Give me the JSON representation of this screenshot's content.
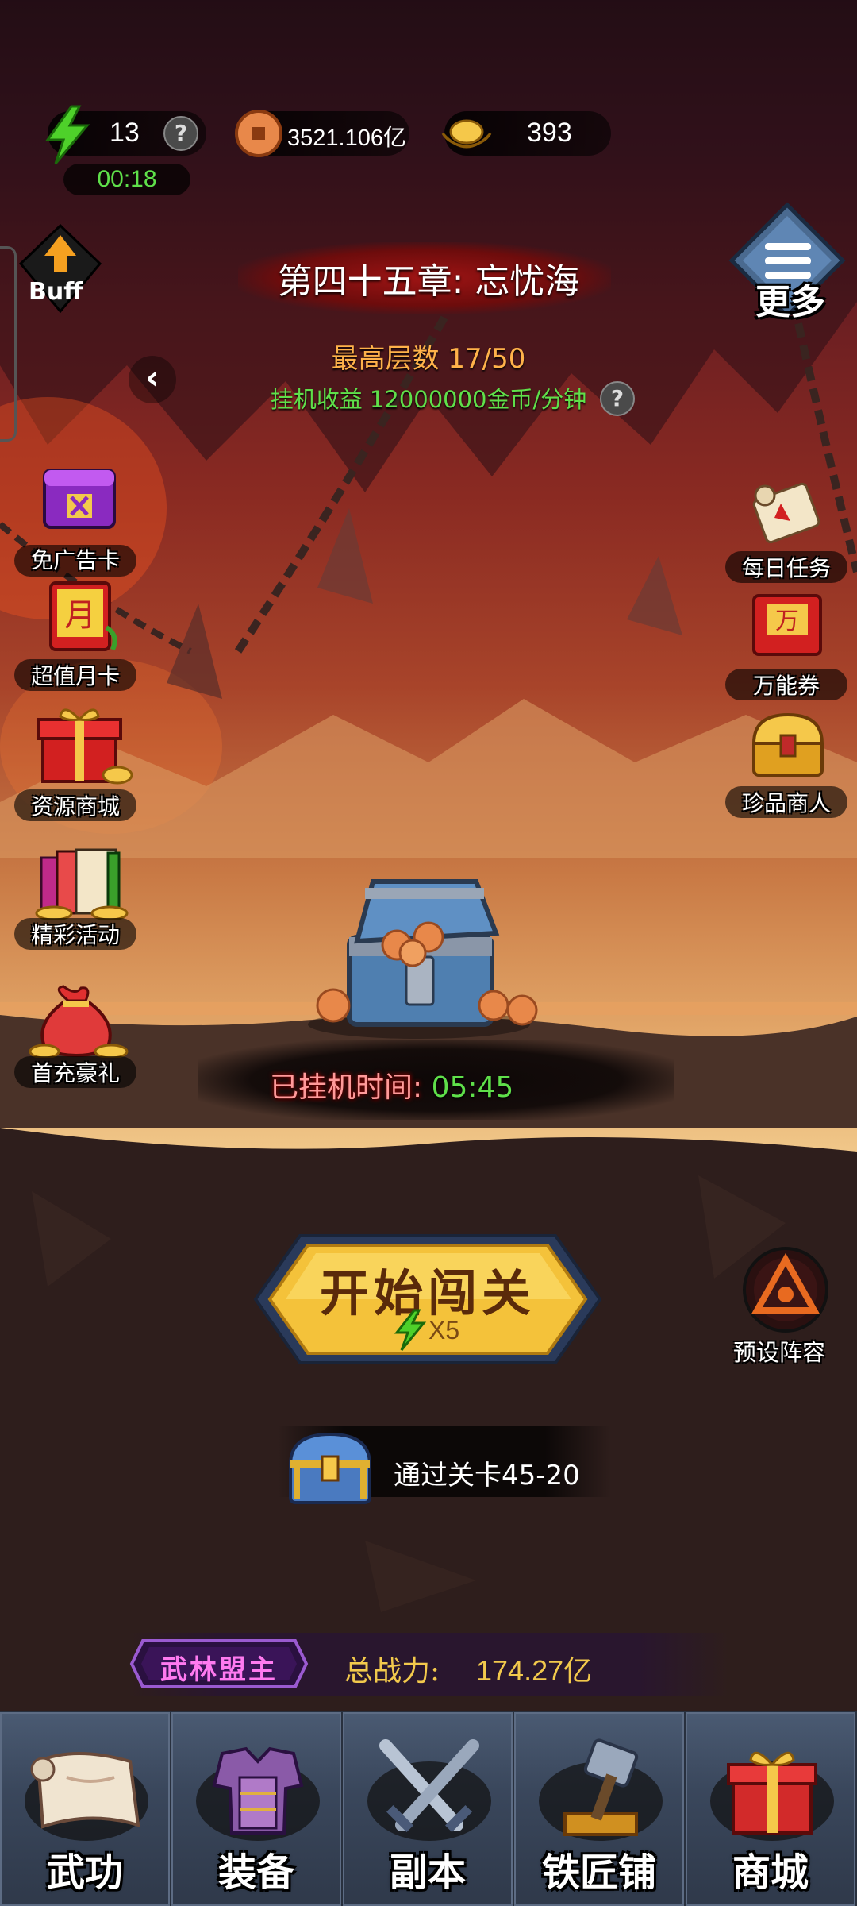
{
  "resources": {
    "energy": "13",
    "energy_timer": "00:18",
    "copper": "3521.106亿",
    "gold": "393"
  },
  "buff_label": "Buff",
  "more_label": "更多",
  "chapter": {
    "title": "第四十五章: 忘忧海",
    "max_floor": "最高层数 17/50",
    "idle_income": "挂机收益 12000000金币/分钟"
  },
  "left_menu": [
    {
      "label": "免广告卡",
      "icon": "ad-free-card-icon"
    },
    {
      "label": "超值月卡",
      "icon": "monthly-card-icon"
    },
    {
      "label": "资源商城",
      "icon": "gift-box-icon"
    },
    {
      "label": "精彩活动",
      "icon": "activity-books-icon"
    },
    {
      "label": "首充豪礼",
      "icon": "money-bag-icon"
    }
  ],
  "right_menu": [
    {
      "label": "每日任务",
      "icon": "scroll-icon"
    },
    {
      "label": "万能券",
      "icon": "universal-coupon-icon"
    },
    {
      "label": "珍品商人",
      "icon": "golden-chest-icon"
    }
  ],
  "idle": {
    "label": "已挂机时间:",
    "time": "05:45"
  },
  "start_button": {
    "label": "开始闯关",
    "cost": "X5"
  },
  "preset_lineup": "预设阵容",
  "reward": {
    "text": "通过关卡45-20"
  },
  "power": {
    "title": "武林盟主",
    "label": "总战力:",
    "value": "174.27亿"
  },
  "nav": [
    {
      "label": "武功",
      "icon": "martial-arts-scroll-icon"
    },
    {
      "label": "装备",
      "icon": "armor-icon"
    },
    {
      "label": "副本",
      "icon": "crossed-swords-icon"
    },
    {
      "label": "铁匠铺",
      "icon": "hammer-anvil-icon"
    },
    {
      "label": "商城",
      "icon": "shop-gift-icon"
    }
  ],
  "colors": {
    "green_text": "#5fe04a",
    "orange_text": "#ffb24a",
    "gold_text": "#f2c94c",
    "nav_bg": "#3a475c"
  }
}
